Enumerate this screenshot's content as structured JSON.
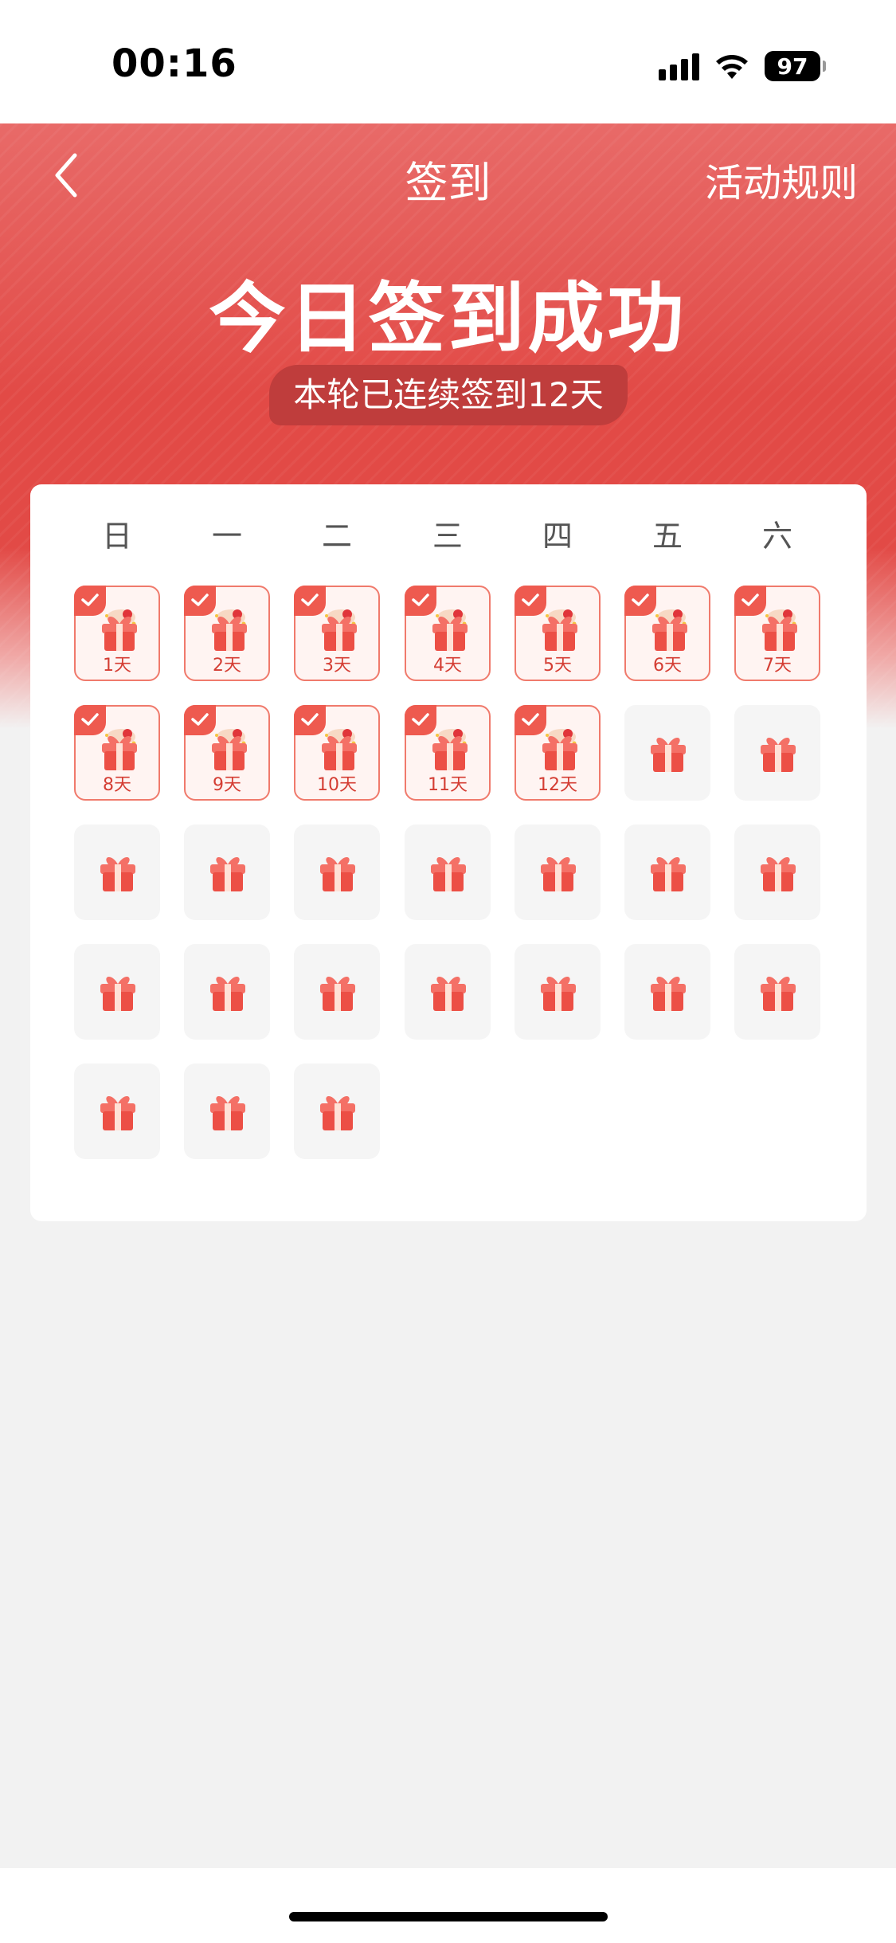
{
  "status_bar": {
    "time": "00:16",
    "battery": "97"
  },
  "nav": {
    "title": "签到",
    "rules": "活动规则"
  },
  "hero": {
    "title": "今日签到成功",
    "streak": "本轮已连续签到12天"
  },
  "weekdays": [
    "日",
    "一",
    "二",
    "三",
    "四",
    "五",
    "六"
  ],
  "calendar": {
    "total_days": 31,
    "checked_days": 12,
    "labels": [
      "1天",
      "2天",
      "3天",
      "4天",
      "5天",
      "6天",
      "7天",
      "8天",
      "9天",
      "10天",
      "11天",
      "12天"
    ]
  },
  "colors": {
    "accent": "#e24a46",
    "checked_border": "#f07a6c",
    "label": "#d43d33"
  },
  "icons": {
    "back": "chevron-left-icon",
    "checked": "check-icon",
    "gift": "gift-icon"
  }
}
